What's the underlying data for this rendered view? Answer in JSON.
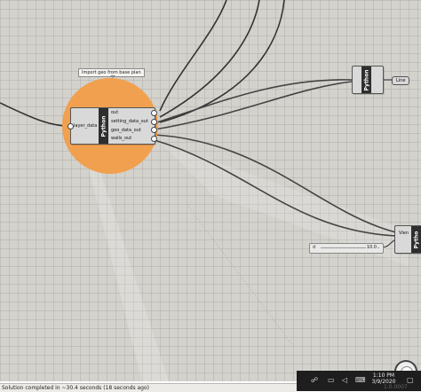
{
  "canvas": {
    "tooltip": "Import geo from base plan",
    "main_component": {
      "label": "Python",
      "input": "layer_data",
      "outputs": [
        "out",
        "setting_data_out",
        "geo_data_out",
        "walls_out"
      ]
    },
    "top_right_component": {
      "label": "Python",
      "line_node": "Line"
    },
    "right_component": {
      "label": "Pytho",
      "port_label": "Vlen"
    },
    "slider": {
      "name": "d",
      "value": "10.0"
    }
  },
  "statusbar": {
    "message": "Solution completed in ~30.4 seconds (18 seconds ago)",
    "version": "1.0.0007"
  },
  "taskbar": {
    "time": "1:10 PM",
    "date": "3/9/2020"
  },
  "icons": [
    "people-icon",
    "network-icon",
    "volume-icon",
    "ime-icon",
    "notification-icon",
    "compass-icon"
  ]
}
